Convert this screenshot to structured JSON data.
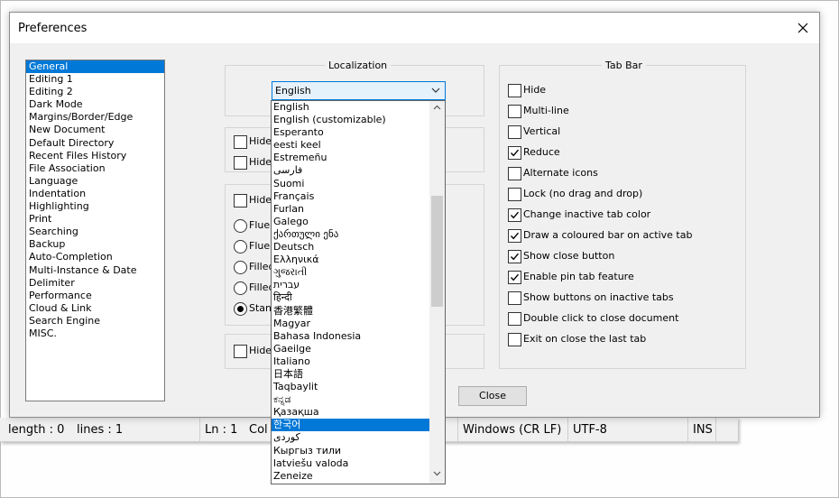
{
  "dialog": {
    "title": "Preferences",
    "close_button": "Close"
  },
  "categories": [
    "General",
    "Editing 1",
    "Editing 2",
    "Dark Mode",
    "Margins/Border/Edge",
    "New Document",
    "Default Directory",
    "Recent Files History",
    "File Association",
    "Language",
    "Indentation",
    "Highlighting",
    "Print",
    "Searching",
    "Backup",
    "Auto-Completion",
    "Multi-Instance & Date",
    "Delimiter",
    "Performance",
    "Cloud & Link",
    "Search Engine",
    "MISC."
  ],
  "selected_category": "General",
  "localization": {
    "title": "Localization",
    "selected": "English",
    "highlighted": "한국어",
    "options": [
      "English",
      "English (customizable)",
      "Esperanto",
      "eesti keel",
      "Estremeñu",
      "فارسی",
      "Suomi",
      "Français",
      "Furlan",
      "Galego",
      "ქართული ენა",
      "Deutsch",
      "Ελληνικά",
      "ગુજરાતી",
      "עברית",
      "हिन्दी",
      "香港繁體",
      "Magyar",
      "Bahasa Indonesia",
      "Gaeilge",
      "Italiano",
      "日本語",
      "Taqbaylit",
      "ಕನ್ನಡ",
      "Қазақша",
      "한국어",
      "کوردی",
      "Кыргыз тили",
      "latviešu valoda",
      "Zeneize"
    ]
  },
  "partial_options": {
    "hide1": "Hide",
    "hide2": "Hide",
    "hide3": "Hide",
    "radio1": "Fluen",
    "radio2": "Fluen",
    "radio3": "Filled",
    "radio4": "Filled",
    "radio5": "Stand",
    "hide4": "Hide"
  },
  "tab_bar": {
    "title": "Tab Bar",
    "options": [
      {
        "label": "Hide",
        "checked": false
      },
      {
        "label": "Multi-line",
        "checked": false
      },
      {
        "label": "Vertical",
        "checked": false
      },
      {
        "label": "Reduce",
        "checked": true
      },
      {
        "label": "Alternate icons",
        "checked": false
      },
      {
        "label": "Lock (no drag and drop)",
        "checked": false
      },
      {
        "label": "Change inactive tab color",
        "checked": true
      },
      {
        "label": "Draw a coloured bar on active tab",
        "checked": true
      },
      {
        "label": "Show close button",
        "checked": true
      },
      {
        "label": "Enable pin tab feature",
        "checked": true
      },
      {
        "label": "Show buttons on inactive tabs",
        "checked": false
      },
      {
        "label": "Double click to close document",
        "checked": false
      },
      {
        "label": "Exit on close the last tab",
        "checked": false
      }
    ]
  },
  "statusbar": {
    "length": "length : 0",
    "lines": "lines : 1",
    "ln": "Ln : 1",
    "col": "Col",
    "eol": "Windows (CR LF)",
    "encoding": "UTF-8",
    "mode": "INS"
  }
}
